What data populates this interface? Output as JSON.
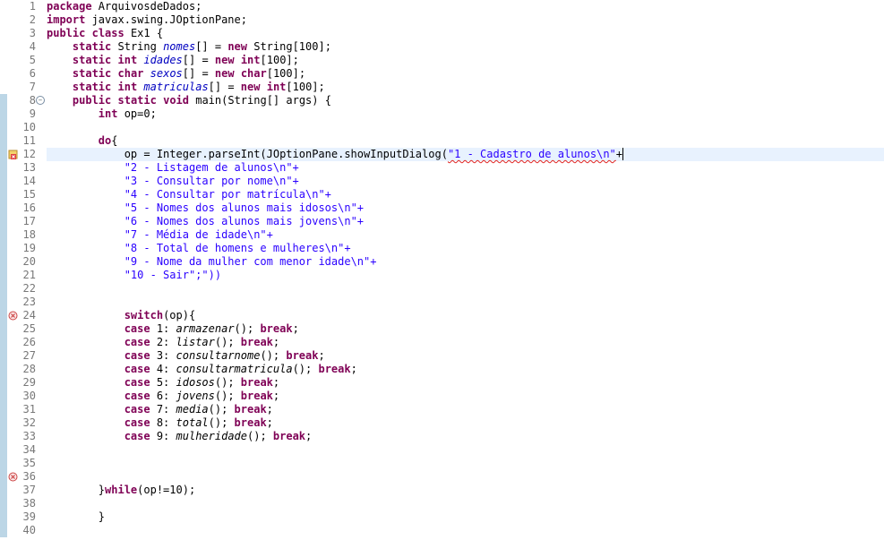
{
  "editor": {
    "lines": [
      {
        "n": "1",
        "marked": false,
        "icon": "",
        "segments": [
          {
            "t": "package",
            "k": "kw"
          },
          {
            "t": " ArquivosdeDados;",
            "k": "txt"
          }
        ]
      },
      {
        "n": "2",
        "marked": false,
        "icon": "",
        "segments": [
          {
            "t": "import",
            "k": "kw"
          },
          {
            "t": " javax.swing.JOptionPane;",
            "k": "txt"
          }
        ]
      },
      {
        "n": "3",
        "marked": false,
        "icon": "",
        "segments": [
          {
            "t": "public",
            "k": "kw"
          },
          {
            "t": " ",
            "k": "txt"
          },
          {
            "t": "class",
            "k": "kw"
          },
          {
            "t": " Ex1 {",
            "k": "txt"
          }
        ]
      },
      {
        "n": "4",
        "marked": false,
        "icon": "",
        "segments": [
          {
            "t": "    ",
            "k": "txt"
          },
          {
            "t": "static",
            "k": "kw"
          },
          {
            "t": " String ",
            "k": "txt"
          },
          {
            "t": "nomes",
            "k": "fld"
          },
          {
            "t": "[] = ",
            "k": "txt"
          },
          {
            "t": "new",
            "k": "kw"
          },
          {
            "t": " String[100];",
            "k": "txt"
          }
        ]
      },
      {
        "n": "5",
        "marked": false,
        "icon": "",
        "segments": [
          {
            "t": "    ",
            "k": "txt"
          },
          {
            "t": "static",
            "k": "kw"
          },
          {
            "t": " ",
            "k": "txt"
          },
          {
            "t": "int",
            "k": "kw"
          },
          {
            "t": " ",
            "k": "txt"
          },
          {
            "t": "idades",
            "k": "fld"
          },
          {
            "t": "[] = ",
            "k": "txt"
          },
          {
            "t": "new",
            "k": "kw"
          },
          {
            "t": " ",
            "k": "txt"
          },
          {
            "t": "int",
            "k": "kw"
          },
          {
            "t": "[100];",
            "k": "txt"
          }
        ]
      },
      {
        "n": "6",
        "marked": false,
        "icon": "",
        "segments": [
          {
            "t": "    ",
            "k": "txt"
          },
          {
            "t": "static",
            "k": "kw"
          },
          {
            "t": " ",
            "k": "txt"
          },
          {
            "t": "char",
            "k": "kw"
          },
          {
            "t": " ",
            "k": "txt"
          },
          {
            "t": "sexos",
            "k": "fld"
          },
          {
            "t": "[] = ",
            "k": "txt"
          },
          {
            "t": "new",
            "k": "kw"
          },
          {
            "t": " ",
            "k": "txt"
          },
          {
            "t": "char",
            "k": "kw"
          },
          {
            "t": "[100];",
            "k": "txt"
          }
        ]
      },
      {
        "n": "7",
        "marked": false,
        "icon": "",
        "segments": [
          {
            "t": "    ",
            "k": "txt"
          },
          {
            "t": "static",
            "k": "kw"
          },
          {
            "t": " ",
            "k": "txt"
          },
          {
            "t": "int",
            "k": "kw"
          },
          {
            "t": " ",
            "k": "txt"
          },
          {
            "t": "matriculas",
            "k": "fld"
          },
          {
            "t": "[] = ",
            "k": "txt"
          },
          {
            "t": "new",
            "k": "kw"
          },
          {
            "t": " ",
            "k": "txt"
          },
          {
            "t": "int",
            "k": "kw"
          },
          {
            "t": "[100];",
            "k": "txt"
          }
        ]
      },
      {
        "n": "8",
        "marked": true,
        "icon": "fold",
        "segments": [
          {
            "t": "    ",
            "k": "txt"
          },
          {
            "t": "public",
            "k": "kw"
          },
          {
            "t": " ",
            "k": "txt"
          },
          {
            "t": "static",
            "k": "kw"
          },
          {
            "t": " ",
            "k": "txt"
          },
          {
            "t": "void",
            "k": "kw"
          },
          {
            "t": " main(String[] args) {",
            "k": "txt"
          }
        ]
      },
      {
        "n": "9",
        "marked": true,
        "icon": "",
        "segments": [
          {
            "t": "        ",
            "k": "txt"
          },
          {
            "t": "int",
            "k": "kw"
          },
          {
            "t": " op=0;",
            "k": "txt"
          }
        ]
      },
      {
        "n": "10",
        "marked": true,
        "icon": "",
        "segments": []
      },
      {
        "n": "11",
        "marked": true,
        "icon": "",
        "segments": [
          {
            "t": "        ",
            "k": "txt"
          },
          {
            "t": "do",
            "k": "kw"
          },
          {
            "t": "{",
            "k": "txt"
          }
        ]
      },
      {
        "n": "12",
        "marked": true,
        "icon": "error-bulb",
        "current": true,
        "segments": [
          {
            "t": "            op = Integer.parseInt(JOptionPane.showInputDialog(",
            "k": "txt"
          },
          {
            "t": "\"1 - Cadastro de alunos\\n\"",
            "k": "str sq"
          },
          {
            "t": "+",
            "k": "txt"
          },
          {
            "t": "",
            "k": "caret"
          }
        ]
      },
      {
        "n": "13",
        "marked": true,
        "icon": "",
        "segments": [
          {
            "t": "            ",
            "k": "txt"
          },
          {
            "t": "\"2 - Listagem de alunos\\n\"+",
            "k": "str"
          }
        ]
      },
      {
        "n": "14",
        "marked": true,
        "icon": "",
        "segments": [
          {
            "t": "            ",
            "k": "txt"
          },
          {
            "t": "\"3 - Consultar por nome\\n\"+",
            "k": "str"
          }
        ]
      },
      {
        "n": "15",
        "marked": true,
        "icon": "",
        "segments": [
          {
            "t": "            ",
            "k": "txt"
          },
          {
            "t": "\"4 - Consultar por matrícula\\n\"+",
            "k": "str"
          }
        ]
      },
      {
        "n": "16",
        "marked": true,
        "icon": "",
        "segments": [
          {
            "t": "            ",
            "k": "txt"
          },
          {
            "t": "\"5 - Nomes dos alunos mais idosos\\n\"+",
            "k": "str"
          }
        ]
      },
      {
        "n": "17",
        "marked": true,
        "icon": "",
        "segments": [
          {
            "t": "            ",
            "k": "txt"
          },
          {
            "t": "\"6 - Nomes dos alunos mais jovens\\n\"+",
            "k": "str"
          }
        ]
      },
      {
        "n": "18",
        "marked": true,
        "icon": "",
        "segments": [
          {
            "t": "            ",
            "k": "txt"
          },
          {
            "t": "\"7 - Média de idade\\n\"+",
            "k": "str"
          }
        ]
      },
      {
        "n": "19",
        "marked": true,
        "icon": "",
        "segments": [
          {
            "t": "            ",
            "k": "txt"
          },
          {
            "t": "\"8 - Total de homens e mulheres\\n\"+",
            "k": "str"
          }
        ]
      },
      {
        "n": "20",
        "marked": true,
        "icon": "",
        "segments": [
          {
            "t": "            ",
            "k": "txt"
          },
          {
            "t": "\"9 - Nome da mulher com menor idade\\n\"+",
            "k": "str"
          }
        ]
      },
      {
        "n": "21",
        "marked": true,
        "icon": "",
        "segments": [
          {
            "t": "            ",
            "k": "txt"
          },
          {
            "t": "\"10 - Sair\";\"))",
            "k": "str"
          }
        ]
      },
      {
        "n": "22",
        "marked": true,
        "icon": "",
        "segments": []
      },
      {
        "n": "23",
        "marked": true,
        "icon": "",
        "segments": []
      },
      {
        "n": "24",
        "marked": true,
        "icon": "error",
        "segments": [
          {
            "t": "            ",
            "k": "txt"
          },
          {
            "t": "switch",
            "k": "kw"
          },
          {
            "t": "(op){",
            "k": "txt"
          }
        ]
      },
      {
        "n": "25",
        "marked": true,
        "icon": "",
        "segments": [
          {
            "t": "            ",
            "k": "txt"
          },
          {
            "t": "case",
            "k": "kw"
          },
          {
            "t": " 1: ",
            "k": "txt"
          },
          {
            "t": "armazenar",
            "k": "ital"
          },
          {
            "t": "(); ",
            "k": "txt"
          },
          {
            "t": "break",
            "k": "kw"
          },
          {
            "t": ";",
            "k": "txt"
          }
        ]
      },
      {
        "n": "26",
        "marked": true,
        "icon": "",
        "segments": [
          {
            "t": "            ",
            "k": "txt"
          },
          {
            "t": "case",
            "k": "kw"
          },
          {
            "t": " 2: ",
            "k": "txt"
          },
          {
            "t": "listar",
            "k": "ital"
          },
          {
            "t": "(); ",
            "k": "txt"
          },
          {
            "t": "break",
            "k": "kw"
          },
          {
            "t": ";",
            "k": "txt"
          }
        ]
      },
      {
        "n": "27",
        "marked": true,
        "icon": "",
        "segments": [
          {
            "t": "            ",
            "k": "txt"
          },
          {
            "t": "case",
            "k": "kw"
          },
          {
            "t": " 3: ",
            "k": "txt"
          },
          {
            "t": "consultarnome",
            "k": "ital"
          },
          {
            "t": "(); ",
            "k": "txt"
          },
          {
            "t": "break",
            "k": "kw"
          },
          {
            "t": ";",
            "k": "txt"
          }
        ]
      },
      {
        "n": "28",
        "marked": true,
        "icon": "",
        "segments": [
          {
            "t": "            ",
            "k": "txt"
          },
          {
            "t": "case",
            "k": "kw"
          },
          {
            "t": " 4: ",
            "k": "txt"
          },
          {
            "t": "consultarmatricula",
            "k": "ital"
          },
          {
            "t": "(); ",
            "k": "txt"
          },
          {
            "t": "break",
            "k": "kw"
          },
          {
            "t": ";",
            "k": "txt"
          }
        ]
      },
      {
        "n": "29",
        "marked": true,
        "icon": "",
        "segments": [
          {
            "t": "            ",
            "k": "txt"
          },
          {
            "t": "case",
            "k": "kw"
          },
          {
            "t": " 5: ",
            "k": "txt"
          },
          {
            "t": "idosos",
            "k": "ital"
          },
          {
            "t": "(); ",
            "k": "txt"
          },
          {
            "t": "break",
            "k": "kw"
          },
          {
            "t": ";",
            "k": "txt"
          }
        ]
      },
      {
        "n": "30",
        "marked": true,
        "icon": "",
        "segments": [
          {
            "t": "            ",
            "k": "txt"
          },
          {
            "t": "case",
            "k": "kw"
          },
          {
            "t": " 6: ",
            "k": "txt"
          },
          {
            "t": "jovens",
            "k": "ital"
          },
          {
            "t": "(); ",
            "k": "txt"
          },
          {
            "t": "break",
            "k": "kw"
          },
          {
            "t": ";",
            "k": "txt"
          }
        ]
      },
      {
        "n": "31",
        "marked": true,
        "icon": "",
        "segments": [
          {
            "t": "            ",
            "k": "txt"
          },
          {
            "t": "case",
            "k": "kw"
          },
          {
            "t": " 7: ",
            "k": "txt"
          },
          {
            "t": "media",
            "k": "ital"
          },
          {
            "t": "(); ",
            "k": "txt"
          },
          {
            "t": "break",
            "k": "kw"
          },
          {
            "t": ";",
            "k": "txt"
          }
        ]
      },
      {
        "n": "32",
        "marked": true,
        "icon": "",
        "segments": [
          {
            "t": "            ",
            "k": "txt"
          },
          {
            "t": "case",
            "k": "kw"
          },
          {
            "t": " 8: ",
            "k": "txt"
          },
          {
            "t": "total",
            "k": "ital"
          },
          {
            "t": "(); ",
            "k": "txt"
          },
          {
            "t": "break",
            "k": "kw"
          },
          {
            "t": ";",
            "k": "txt"
          }
        ]
      },
      {
        "n": "33",
        "marked": true,
        "icon": "",
        "segments": [
          {
            "t": "            ",
            "k": "txt"
          },
          {
            "t": "case",
            "k": "kw"
          },
          {
            "t": " 9: ",
            "k": "txt"
          },
          {
            "t": "mulheridade",
            "k": "ital"
          },
          {
            "t": "(); ",
            "k": "txt"
          },
          {
            "t": "break",
            "k": "kw"
          },
          {
            "t": ";",
            "k": "txt"
          }
        ]
      },
      {
        "n": "34",
        "marked": true,
        "icon": "",
        "segments": []
      },
      {
        "n": "35",
        "marked": true,
        "icon": "",
        "segments": []
      },
      {
        "n": "36",
        "marked": true,
        "icon": "error",
        "segments": []
      },
      {
        "n": "37",
        "marked": true,
        "icon": "",
        "segments": [
          {
            "t": "        }",
            "k": "txt"
          },
          {
            "t": "while",
            "k": "kw"
          },
          {
            "t": "(op!=10);",
            "k": "txt"
          }
        ]
      },
      {
        "n": "38",
        "marked": true,
        "icon": "",
        "segments": []
      },
      {
        "n": "39",
        "marked": true,
        "icon": "",
        "segments": [
          {
            "t": "        }",
            "k": "txt"
          }
        ]
      },
      {
        "n": "40",
        "marked": true,
        "icon": "",
        "segments": []
      }
    ]
  }
}
